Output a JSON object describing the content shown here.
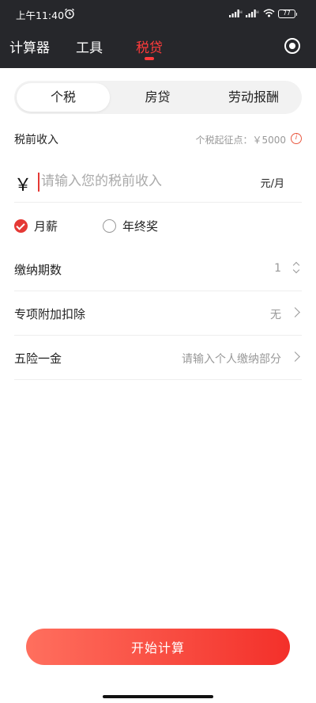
{
  "status_bar": {
    "time": "上午11:40",
    "battery": "77"
  },
  "nav": {
    "tabs": [
      {
        "label": "计算器"
      },
      {
        "label": "工具"
      },
      {
        "label": "税贷"
      }
    ],
    "active_index": 2
  },
  "segments": [
    {
      "label": "个税"
    },
    {
      "label": "房贷"
    },
    {
      "label": "劳动报酬"
    }
  ],
  "income": {
    "label": "税前收入",
    "threshold": "个税起征点：￥5000",
    "currency_symbol": "￥",
    "placeholder": "请输入您的税前收入",
    "unit": "元/月"
  },
  "radio": {
    "options": [
      {
        "label": "月薪",
        "checked": true
      },
      {
        "label": "年终奖",
        "checked": false
      }
    ]
  },
  "rows": [
    {
      "label": "缴纳期数",
      "value": "1"
    },
    {
      "label": "专项附加扣除",
      "value": "无"
    },
    {
      "label": "五险一金",
      "value": "请输入个人缴纳部分"
    }
  ],
  "start_button": "开始计算",
  "colors": {
    "accent": "#e53935",
    "header_bg": "#26272b"
  }
}
